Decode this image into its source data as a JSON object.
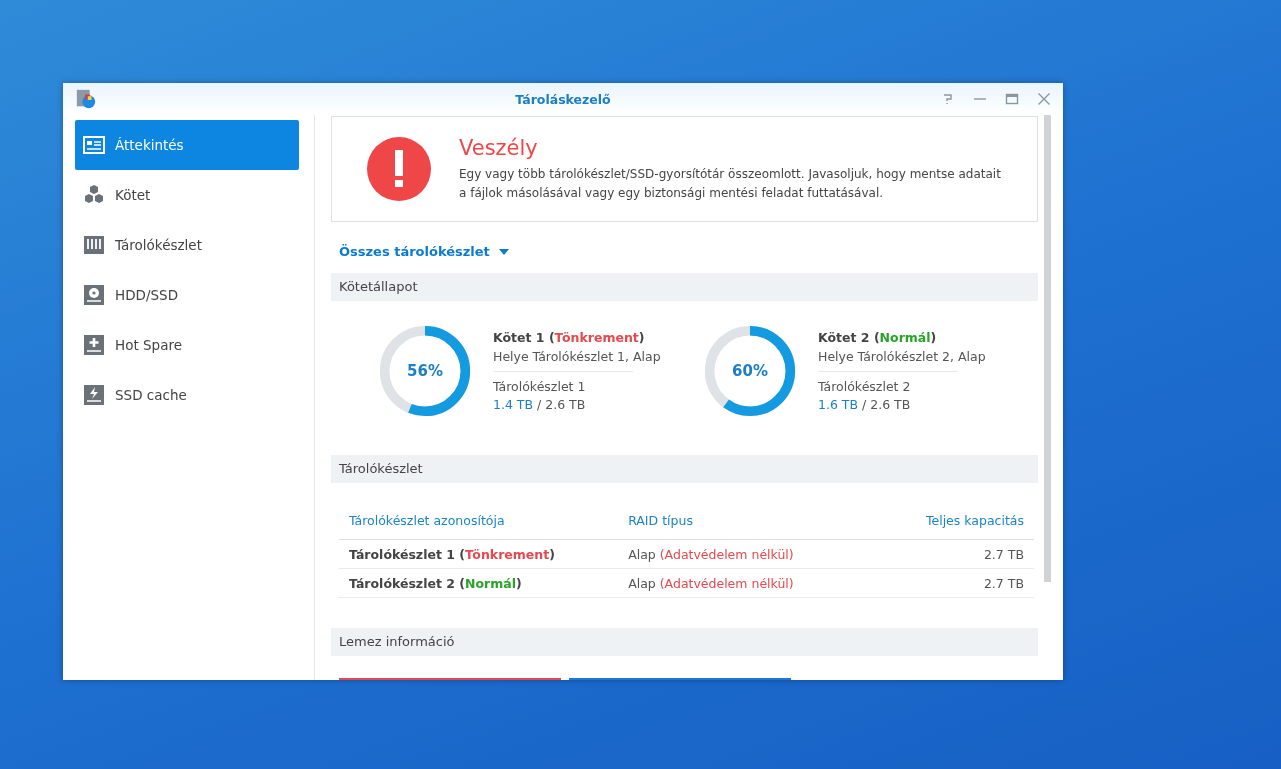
{
  "window": {
    "title": "Tároláskezelő"
  },
  "sidebar": {
    "items": [
      {
        "label": "Áttekintés",
        "kind": "overview",
        "selected": true
      },
      {
        "label": "Kötet",
        "kind": "cubes",
        "selected": false
      },
      {
        "label": "Tárolókészlet",
        "kind": "pool",
        "selected": false
      },
      {
        "label": "HDD/SSD",
        "kind": "disk",
        "selected": false
      },
      {
        "label": "Hot Spare",
        "kind": "plus",
        "selected": false
      },
      {
        "label": "SSD cache",
        "kind": "bolt",
        "selected": false
      }
    ]
  },
  "alert": {
    "title": "Veszély",
    "message": "Egy vagy több tárolókészlet/SSD-gyorsítótár összeomlott. Javasoljuk, hogy mentse adatait a fájlok másolásával vagy egy biztonsági mentési feladat futtatásával."
  },
  "pool_filter": {
    "label": "Összes tárolókészlet"
  },
  "volume_section": {
    "title": "Kötetállapot"
  },
  "volumes": [
    {
      "name": "Kötet 1 (",
      "status": "Tönkrement",
      "close": ")",
      "color": "#e5484d",
      "percent": "56%",
      "level": 0.56,
      "location": "Helye Tárolókészlet 1, Alap",
      "pool": "Tárolókészlet 1",
      "used": "1.4 TB",
      "total": "/ 2.6 TB"
    },
    {
      "name": "Kötet 2 (",
      "status": "Normál",
      "close": ")",
      "color": "#28a428",
      "percent": "60%",
      "level": 0.6,
      "location": "Helye Tárolókészlet 2, Alap",
      "pool": "Tárolókészlet 2",
      "used": "1.6 TB",
      "total": "/ 2.6 TB"
    }
  ],
  "pool_section": {
    "title": "Tárolókészlet"
  },
  "pool_table": {
    "columns": [
      "Tárolókészlet azonosítója",
      "RAID típus",
      "Teljes kapacitás"
    ],
    "rows": [
      {
        "name": "Tárolókészlet 1 (",
        "status": "Tönkrement",
        "close": ")",
        "color": "#e5484d",
        "raid": "Alap",
        "raid_note": "(Adatvédelem nélkül)",
        "capacity": "2.7 TB"
      },
      {
        "name": "Tárolókészlet 2 (",
        "status": "Normál",
        "close": ")",
        "color": "#28a428",
        "raid": "Alap",
        "raid_note": "(Adatvédelem nélkül)",
        "capacity": "2.7 TB"
      }
    ]
  },
  "disk_section": {
    "title": "Lemez információ"
  },
  "disk_cards": [
    {
      "color": "#e8474b"
    },
    {
      "color": "#1e78d2"
    }
  ]
}
